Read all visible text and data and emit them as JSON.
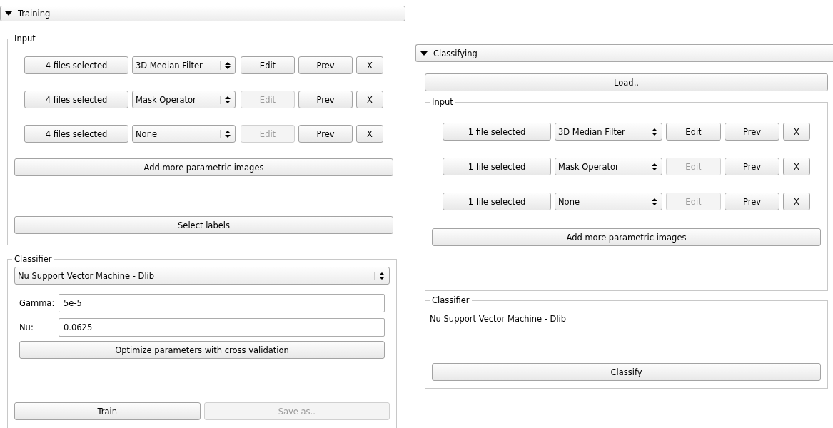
{
  "training": {
    "title": "Training",
    "expanded": true,
    "input": {
      "title": "Input",
      "rows": [
        {
          "files": "4 files selected",
          "filter": "3D Median Filter",
          "edit": "Edit",
          "edit_disabled": false,
          "prev": "Prev",
          "remove": "X"
        },
        {
          "files": "4 files selected",
          "filter": "Mask Operator",
          "edit": "Edit",
          "edit_disabled": true,
          "prev": "Prev",
          "remove": "X"
        },
        {
          "files": "4 files selected",
          "filter": "None",
          "edit": "Edit",
          "edit_disabled": true,
          "prev": "Prev",
          "remove": "X"
        }
      ],
      "add_button": "Add more parametric images",
      "labels_button": "Select labels"
    },
    "classifier": {
      "title": "Classifier",
      "method": "Nu Support Vector Machine - Dlib",
      "params": [
        {
          "label": "Gamma:",
          "value": "5e-5"
        },
        {
          "label": "Nu:",
          "value": "0.0625"
        }
      ],
      "optimize_button": "Optimize parameters with cross validation",
      "train_button": {
        "label": "Train",
        "disabled": false
      },
      "save_button": {
        "label": "Save as..",
        "disabled": true
      }
    }
  },
  "classifying": {
    "title": "Classifying",
    "expanded": true,
    "load_button": "Load..",
    "input": {
      "title": "Input",
      "rows": [
        {
          "files": "1 file selected",
          "filter": "3D Median Filter",
          "edit": "Edit",
          "edit_disabled": false,
          "prev": "Prev",
          "remove": "X"
        },
        {
          "files": "1 file selected",
          "filter": "Mask Operator",
          "edit": "Edit",
          "edit_disabled": true,
          "prev": "Prev",
          "remove": "X"
        },
        {
          "files": "1 file selected",
          "filter": "None",
          "edit": "Edit",
          "edit_disabled": true,
          "prev": "Prev",
          "remove": "X"
        }
      ],
      "add_button": "Add more parametric images"
    },
    "classifier": {
      "title": "Classifier",
      "method": "Nu Support Vector Machine - Dlib",
      "classify_button": "Classify"
    }
  }
}
